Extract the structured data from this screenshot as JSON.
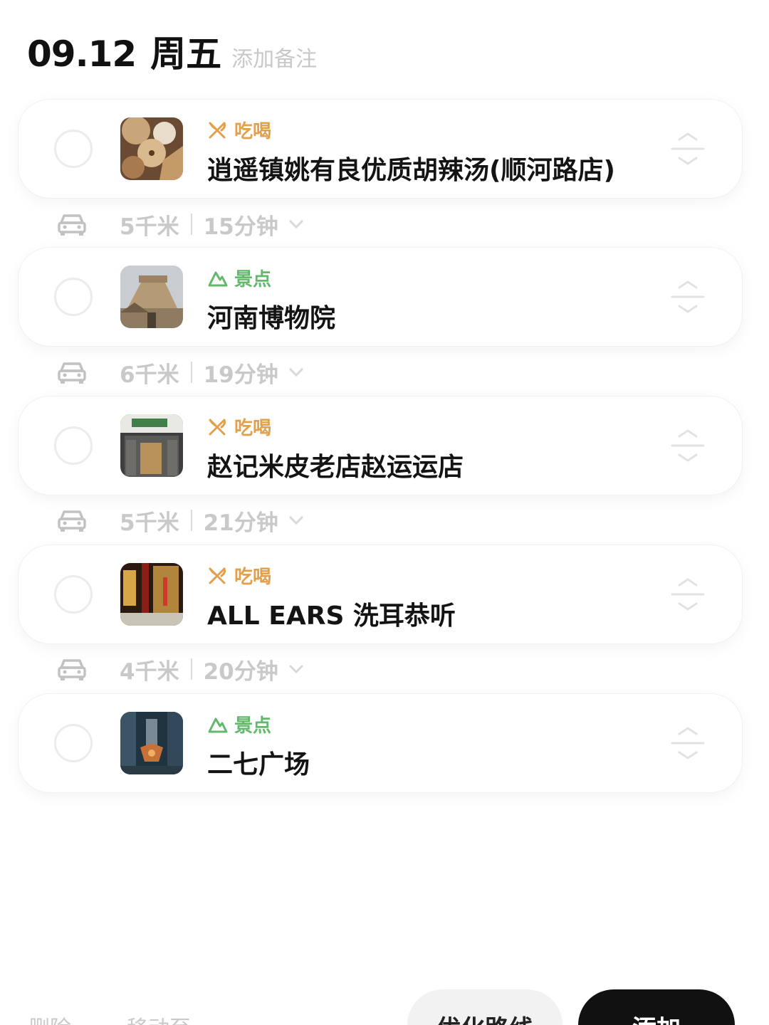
{
  "header": {
    "date": "09.12",
    "weekday": "周五",
    "note_placeholder": "添加备注"
  },
  "category_colors": {
    "food": "#e2a04c",
    "sight": "#62b86b"
  },
  "stops": [
    {
      "category": "吃喝",
      "category_icon": "fork-knife-icon",
      "name": "逍遥镇姚有良优质胡辣汤(顺河路店)"
    },
    {
      "category": "景点",
      "category_icon": "mountain-icon",
      "name": "河南博物院"
    },
    {
      "category": "吃喝",
      "category_icon": "fork-knife-icon",
      "name": "赵记米皮老店赵运运店"
    },
    {
      "category": "吃喝",
      "category_icon": "fork-knife-icon",
      "name": "ALL EARS 洗耳恭听"
    },
    {
      "category": "景点",
      "category_icon": "mountain-icon",
      "name": "二七广场"
    }
  ],
  "legs": [
    {
      "mode_icon": "car-icon",
      "distance": "5千米",
      "duration": "15分钟"
    },
    {
      "mode_icon": "car-icon",
      "distance": "6千米",
      "duration": "19分钟"
    },
    {
      "mode_icon": "car-icon",
      "distance": "5千米",
      "duration": "21分钟"
    },
    {
      "mode_icon": "car-icon",
      "distance": "4千米",
      "duration": "20分钟"
    }
  ],
  "bottom_bar": {
    "delete_label": "删除",
    "move_label": "移动至",
    "optimize_label": "优化路线",
    "add_label": "添加"
  }
}
